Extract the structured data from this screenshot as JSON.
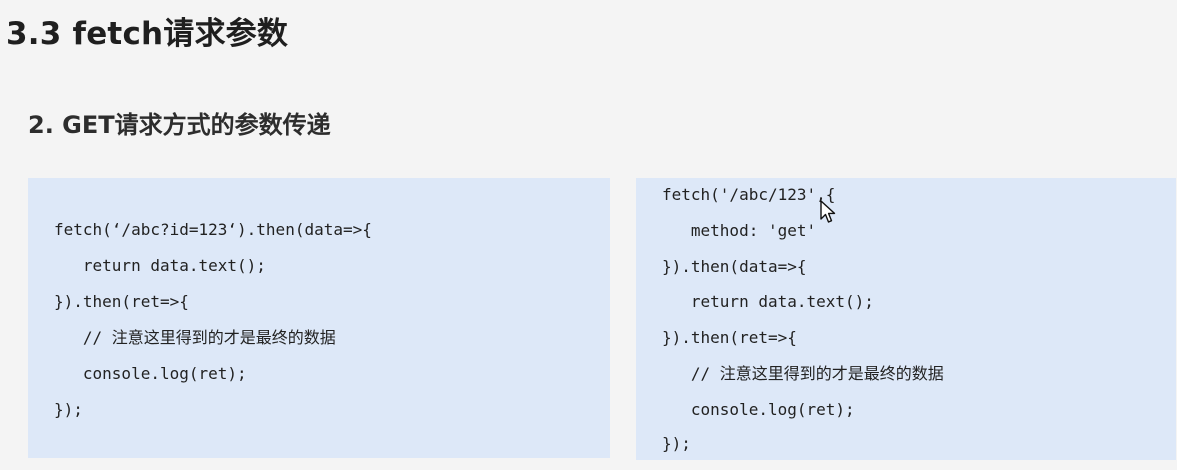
{
  "page": {
    "title": "3.3 fetch请求参数",
    "subtitle": "2. GET请求方式的参数传递"
  },
  "code_left": {
    "lines": [
      "fetch(‘/abc?id=123‘).then(data=>{",
      "   return data.text();",
      "}).then(ret=>{",
      "   // 注意这里得到的才是最终的数据",
      "   console.log(ret);",
      "});"
    ]
  },
  "code_right": {
    "lines": [
      "fetch('/abc/123',{",
      "   method: 'get'",
      "}).then(data=>{",
      "   return data.text();",
      "}).then(ret=>{",
      "   // 注意这里得到的才是最终的数据",
      "   console.log(ret);",
      "});"
    ]
  },
  "icons": {
    "cursor": "mouse-pointer-icon"
  }
}
